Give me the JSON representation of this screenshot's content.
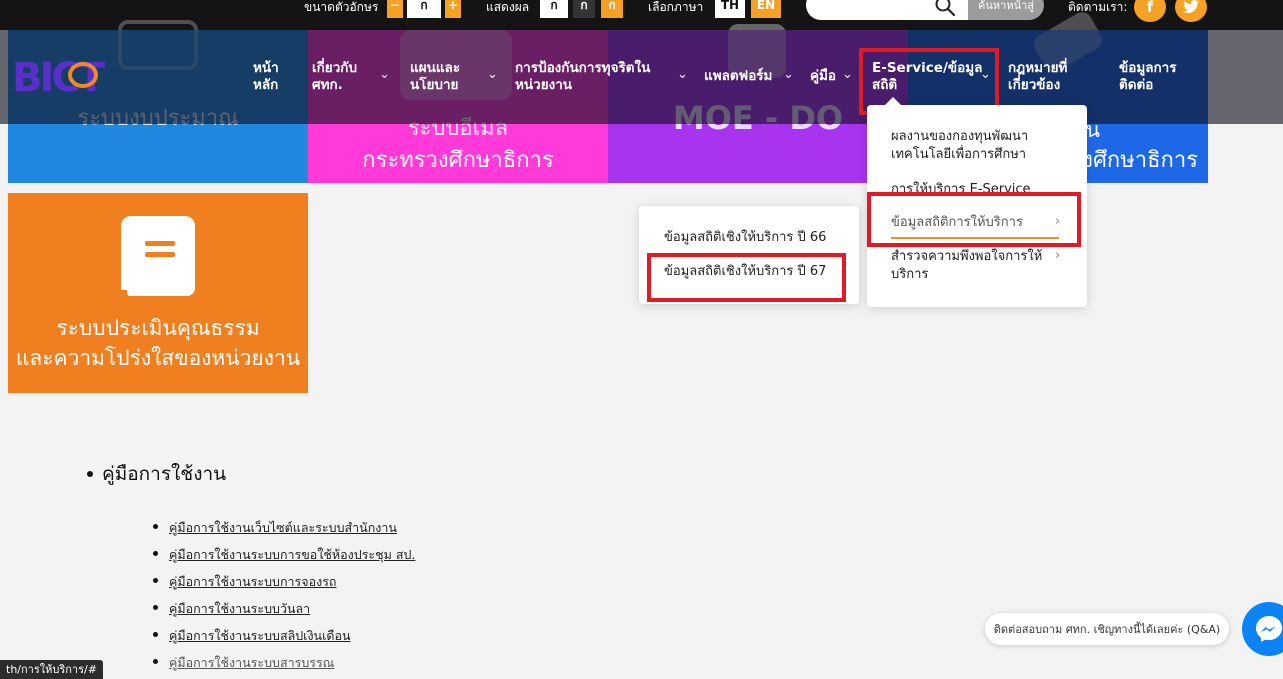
{
  "topbar": {
    "font_size_label": "ขนาดตัวอักษร",
    "font_minus": "−",
    "font_normal": "ก",
    "font_plus": "+",
    "display_label": "แสดงผล",
    "display_white": "ก",
    "display_black": "ก",
    "display_orange": "ก",
    "language_label": "เลือกภาษา",
    "lang_th": "TH",
    "lang_en": "EN",
    "search_placeholder": "",
    "search_button": "ค้นหาหน้าสู่",
    "follow_label": "ติดตามเรา:",
    "facebook_glyph": "f",
    "twitter_glyph": "🐦"
  },
  "tiles": {
    "t1": "ระบบงบประมาณ",
    "t2_line1": "ระบบอีเมล",
    "t2_line2": "กระทรวงศึกษาธิการ",
    "t3": "MOE - DO",
    "t4_line1": "เรียน",
    "t4_line2": "วงศึกษาธิการ",
    "t5_line1": "ระบบประเมินคุณธรรม",
    "t5_line2": "และความโปร่งใสของหน่วยงาน"
  },
  "nav": {
    "logo_text": "BICT",
    "home": "หน้า\nหลัก",
    "about": "เกี่ยวกับ\nศทก.",
    "plans": "แผนและ\nนโยบาย",
    "anticorruption": "การป้องกันการทุจริตใน\nหน่วยงาน",
    "platform": "แพลตฟอร์ม",
    "manual": "คู่มือ",
    "eservice": "E-Service/ข้อมูล\nสถิติ",
    "laws": "กฎหมายที่\nเกี่ยวข้อง",
    "contact": "ข้อมูลการ\nติดต่อ"
  },
  "dropdown_main": {
    "item1": "ผลงานของกองทุนพัฒนา\nเทคโนโลยีเพื่อการศึกษา",
    "item2": "การให้บริการ E-Service",
    "item3": "ข้อมูลสถิติการให้บริการ",
    "item4": "สำรวจความพึงพอใจการให้\nบริการ"
  },
  "dropdown_sub": {
    "item1": "ข้อมูลสถิติเชิงให้บริการ ปี 66",
    "item2": "ข้อมูลสถิติเชิงให้บริการ ปี 67"
  },
  "content": {
    "heading": "คู่มือการใช้งาน",
    "links": [
      "คู่มือการใช้งานเว็บไซต์และระบบสำนักงาน",
      "คู่มือการใช้งานระบบการขอใช้ห้องประชุม สป.",
      "คู่มือการใช้งานระบบการจองรถ",
      "คู่มือการใช้งานระบบวันลา",
      "คู่มือการใช้งานระบบสลิปเงินเดือน",
      "คู่มือการใช้งานระบบสารบรรณ"
    ]
  },
  "status_url": "th/การให้บริการ/#",
  "chat": {
    "text": "ติดต่อสอบถาม ศทก. เชิญทางนี้ได้เลยค่ะ (Q&A)"
  },
  "colors": {
    "tile_blue": "#2188e0",
    "tile_pink": "#ff3ad9",
    "tile_purple": "#a934f0",
    "tile_orange": "#f07f1f",
    "accent_orange": "#f5a224",
    "highlight_red": "#e01b24"
  }
}
